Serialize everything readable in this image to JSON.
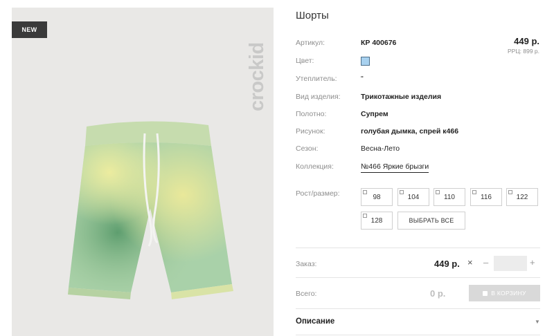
{
  "badge": "NEW",
  "brand": "crockid",
  "product": {
    "title": "Шорты",
    "price": "449 р.",
    "rrp": "РРЦ: 899 р."
  },
  "specs": {
    "article_label": "Артикул:",
    "article_value": "КР 400676",
    "color_label": "Цвет:",
    "color_hex": "#a8d1ef",
    "insulation_label": "Утеплитель:",
    "insulation_value": "\"",
    "type_label": "Вид изделия:",
    "type_value": "Трикотажные изделия",
    "fabric_label": "Полотно:",
    "fabric_value": "Супрем",
    "pattern_label": "Рисунок:",
    "pattern_value": "голубая дымка, спрей к466",
    "season_label": "Сезон:",
    "season_value": "Весна-Лето",
    "collection_label": "Коллекция:",
    "collection_value": "№466 Яркие брызги"
  },
  "sizes": {
    "label": "Рост/размер:",
    "options": [
      "98",
      "104",
      "110",
      "116",
      "122",
      "128"
    ],
    "select_all": "ВЫБРАТЬ ВСЕ"
  },
  "order": {
    "label": "Заказ:",
    "price": "449 р.",
    "times_icon": "×",
    "minus": "–",
    "plus": "+",
    "quantity": ""
  },
  "total": {
    "label": "Всего:",
    "value": "0 р.",
    "cart_button": "В КОРЗИНУ",
    "cart_icon": "bag-icon"
  },
  "description": {
    "title": "Описание",
    "caret_icon": "caret-down-icon"
  }
}
